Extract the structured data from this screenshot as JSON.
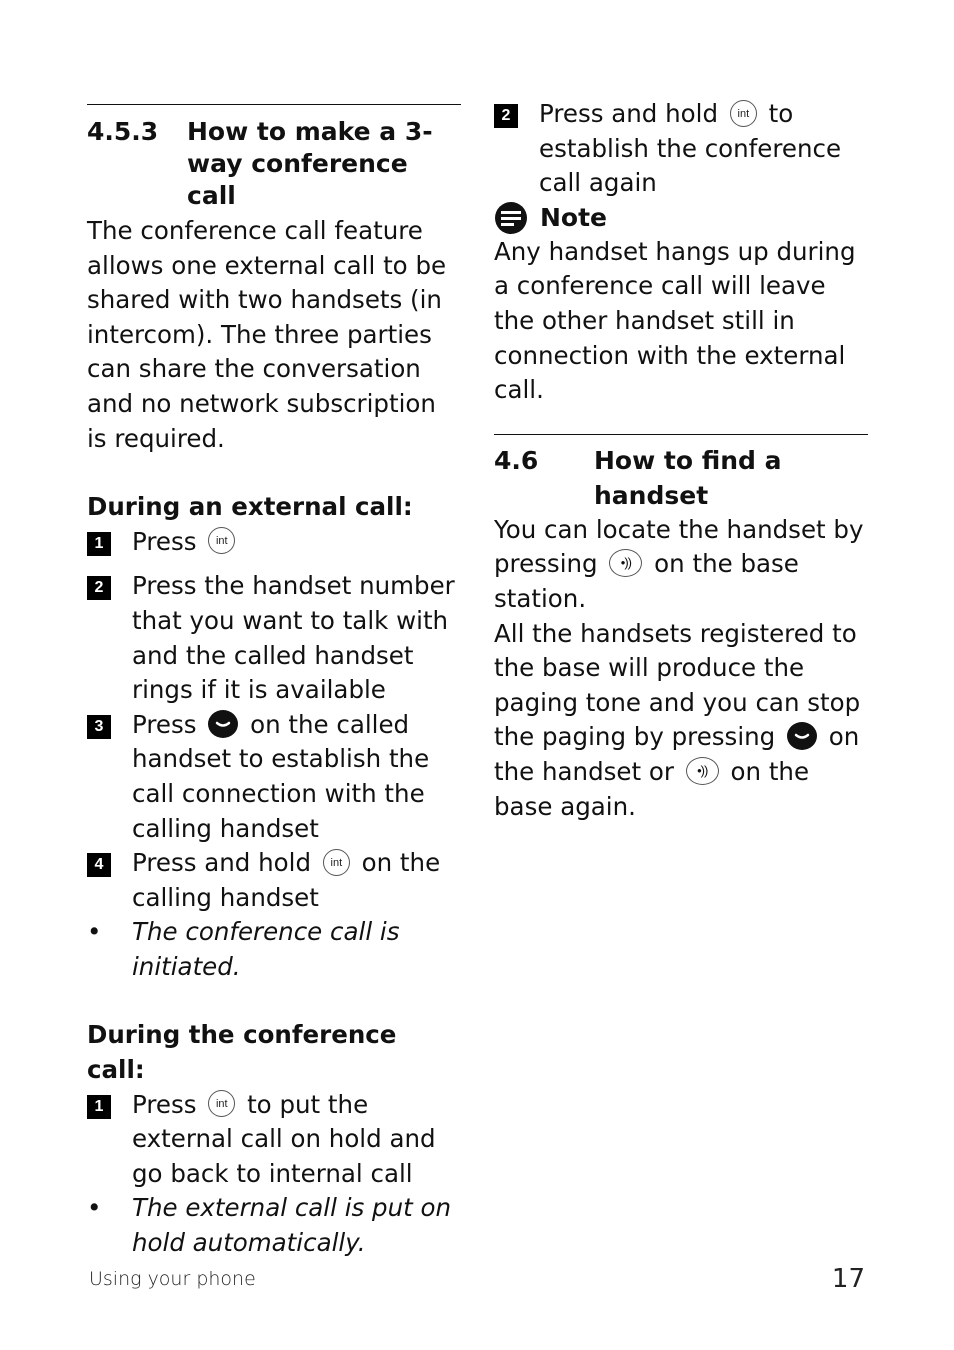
{
  "section_453": {
    "number": "4.5.3",
    "title": "How to make a 3-way conference call",
    "intro": "The conference call feature allows one external call to be shared with two handsets (in intercom). The three parties can share the conversation and no network subscription is required."
  },
  "during_external": {
    "heading": "During an external call:",
    "steps": [
      {
        "n": "1",
        "pre": "Press",
        "icon": "int-key-icon",
        "post": ""
      },
      {
        "n": "2",
        "text": "Press the handset number that you want to talk with and the called handset rings if it is available"
      },
      {
        "n": "3",
        "pre": "Press",
        "icon": "talk-key-icon",
        "post": "on the called handset to establish the call connection with the calling handset"
      },
      {
        "n": "4",
        "pre": "Press and hold",
        "icon": "int-key-icon",
        "post": "on the calling handset"
      }
    ],
    "result": "The conference call is initiated."
  },
  "during_conference": {
    "heading": "During the conference call:",
    "steps": [
      {
        "n": "1",
        "pre": "Press",
        "icon": "int-key-icon",
        "post": "to put the external call on hold and go back to internal call"
      },
      {
        "n": "2",
        "pre": "Press and hold",
        "icon": "int-key-icon",
        "post": "to establish the conference call again"
      }
    ],
    "result": "The external call is put on hold automatically."
  },
  "note": {
    "label": "Note",
    "text": "Any handset hangs up during a conference call will leave the other handset still in connection with the external call."
  },
  "section_46": {
    "number": "4.6",
    "title": "How to find a handset",
    "para1_pre": "You can locate the handset by pressing",
    "para1_post": "on the base station.",
    "para2_pre": "All the handsets registered to the base will produce the paging tone and you can stop the paging by pressing",
    "para2_mid": "on the handset or",
    "para2_post": "on the base again."
  },
  "icons": {
    "int_label": "int",
    "page_label": "•))"
  },
  "footer": {
    "section": "Using your phone",
    "page_number": "17"
  }
}
